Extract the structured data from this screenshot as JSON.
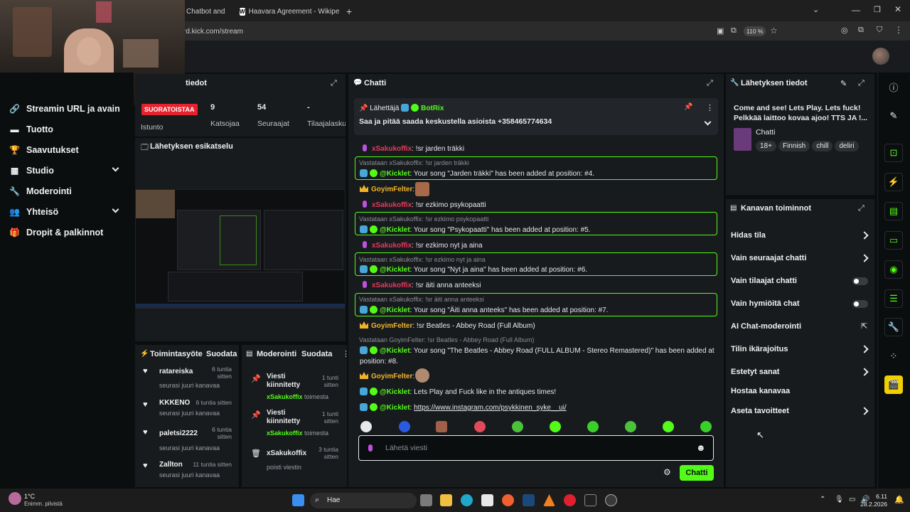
{
  "browser": {
    "tabs": [
      {
        "label": "Chatbot and"
      },
      {
        "label": "Haavara Agreement - Wikipedia"
      }
    ],
    "address": "rd.kick.com/stream",
    "zoom": "110 %"
  },
  "sidebar": {
    "items": [
      {
        "label": "Streamin URL ja avain"
      },
      {
        "label": "Tuotto"
      },
      {
        "label": "Saavutukset"
      },
      {
        "label": "Studio"
      },
      {
        "label": "Moderointi"
      },
      {
        "label": "Yhteisö"
      },
      {
        "label": "Dropit & palkinnot"
      }
    ]
  },
  "stats": {
    "title_fragment": "tiedot",
    "live_badge": "SUORATOISTAA",
    "session_label": "Istunto",
    "viewers_value": "9",
    "viewers_label": "Katsojaa",
    "followers_value": "54",
    "followers_label": "Seuraajat",
    "subs_value": "-",
    "subs_label": "Tilaajalasku"
  },
  "preview": {
    "title": "Lähetyksen esikatselu"
  },
  "activity": {
    "title": "Toimintasyöte",
    "filter": "Suodata",
    "rows": [
      {
        "name": "ratareiska",
        "time": "6 tuntia sitten",
        "sub": "seurasi juuri kanavaa"
      },
      {
        "name": "KKKENO",
        "time": "6 tuntia sitten",
        "sub": "seurasi juuri kanavaa"
      },
      {
        "name": "paletsi2222",
        "time": "6 tuntia sitten",
        "sub": "seurasi juuri kanavaa"
      },
      {
        "name": "Zallton",
        "time": "11 tuntia sitten",
        "sub": "seurasi juuri kanavaa"
      }
    ]
  },
  "moderation": {
    "title": "Moderointi",
    "filter": "Suodata",
    "rows": [
      {
        "title": "Viesti kiinnitetty",
        "user": "xSakukoffix",
        "suffix": "toimesta",
        "time": "1 tunti sitten"
      },
      {
        "title": "Viesti kiinnitetty",
        "user": "xSakukoffix",
        "suffix": "toimesta",
        "time": "1 tunti sitten"
      },
      {
        "title": "xSakukoffix",
        "user": "",
        "suffix": "poisti viestin",
        "time": "3 tuntia sitten"
      }
    ]
  },
  "chat": {
    "title": "Chatti",
    "pinned": {
      "sender_label": "Lähettäjä",
      "sender": "BotRix",
      "text": "Saa ja pitää saada keskustella asioista +358465774634"
    },
    "messages": [
      {
        "kind": "user",
        "user": "xSakukoffix",
        "text": ": !sr jarden träkki"
      },
      {
        "kind": "reply",
        "head": "Vastataan xSakukoffix: !sr jarden träkki",
        "user": "@Kicklet",
        "text": ": Your song \"Jarden träkki\" has been added at position: #4."
      },
      {
        "kind": "gold",
        "user": "GoyimFelter",
        "text": ":"
      },
      {
        "kind": "user",
        "user": "xSakukoffix",
        "text": ": !sr ezkimo psykopaatti"
      },
      {
        "kind": "reply",
        "head": "Vastataan xSakukoffix: !sr ezkimo psykopaatti",
        "user": "@Kicklet",
        "text": ": Your song \"Psykopaatti\" has been added at position: #5."
      },
      {
        "kind": "user",
        "user": "xSakukoffix",
        "text": ": !sr ezkimo nyt ja aina"
      },
      {
        "kind": "reply",
        "head": "Vastataan xSakukoffix: !sr ezkimo nyt ja aina",
        "user": "@Kicklet",
        "text": ": Your song \"Nyt ja aina\" has been added at position: #6."
      },
      {
        "kind": "user",
        "user": "xSakukoffix",
        "text": ": !sr äiti anna anteeksi"
      },
      {
        "kind": "reply",
        "head": "Vastataan xSakukoffix: !sr äiti anna anteeksi",
        "user": "@Kicklet",
        "text": ": Your song \"Äiti anna anteeks\" has been added at position: #7."
      },
      {
        "kind": "gold",
        "user": "GoyimFelter",
        "text": ": !sr Beatles - Abbey Road (Full Album)"
      },
      {
        "kind": "reply2",
        "head": "Vastataan GoyimFelter: !sr Beatles - Abbey Road (Full Album)",
        "user": "@Kicklet",
        "text": ": Your song \"The Beatles - Abbey Road (FULL ALBUM - Stereo Remastered)\" has been added at position: #8."
      },
      {
        "kind": "gold",
        "user": "GoyimFelter",
        "text": ":"
      },
      {
        "kind": "bot",
        "user": "@Kicklet",
        "text": ": Lets Play and Fuck like in the antiques times!"
      },
      {
        "kind": "bot",
        "user": "@Kicklet",
        "text": ": ",
        "link": "https://www.instagram.com/psykkinen_syke__ui/"
      }
    ],
    "input_placeholder": "Lähetä viesti",
    "send_label": "Chatti"
  },
  "stream_info": {
    "title": "Lähetyksen tiedot",
    "stream_title": "Come and see! Lets Play. Lets fuck! Pelkkää laittoo kovaa ajoo! TTS JA !...",
    "category": "Chatti",
    "tags": [
      "18+",
      "Finnish",
      "chill",
      "deliri"
    ]
  },
  "channel_actions": {
    "title": "Kanavan toiminnot",
    "rows": [
      {
        "label": "Hidas tila",
        "control": "chevron"
      },
      {
        "label": "Vain seuraajat chatti",
        "control": "chevron"
      },
      {
        "label": "Vain tilaajat chatti",
        "control": "toggle"
      },
      {
        "label": "Vain hymiöitä chat",
        "control": "toggle"
      },
      {
        "label": "AI Chat-moderointi",
        "control": "external"
      },
      {
        "label": "Tilin ikärajoitus",
        "control": "chevron"
      },
      {
        "label": "Estetyt sanat",
        "control": "chevron"
      },
      {
        "label": "Hostaa kanavaa",
        "control": "none"
      },
      {
        "label": "Aseta tavoitteet",
        "control": "chevron"
      }
    ]
  },
  "taskbar": {
    "weather_temp": "1°C",
    "weather_desc": "Enimm. pilvistä",
    "search": "Hae",
    "time": "6.11",
    "date": "28.2.2026"
  },
  "colors": {
    "accent": "#53fc18",
    "live": "#e5232e",
    "panel": "#181b1e",
    "background": "#0b0e0f"
  }
}
